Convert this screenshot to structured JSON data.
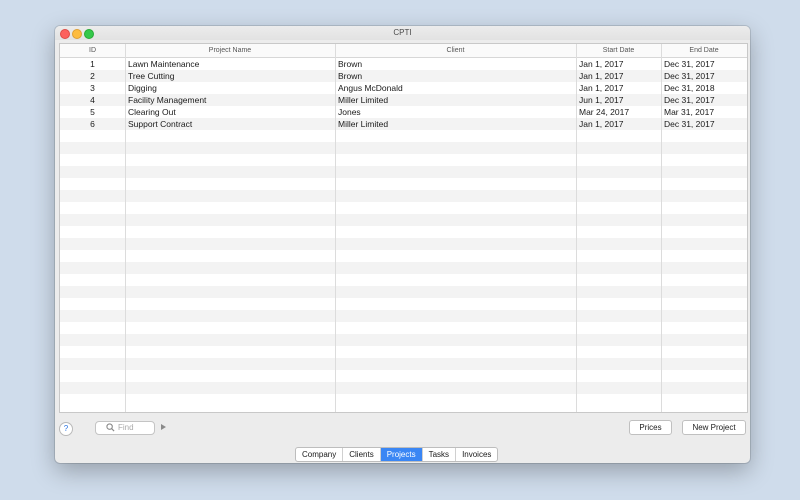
{
  "window": {
    "title": "CPTI"
  },
  "table": {
    "columns": [
      "ID",
      "Project Name",
      "Client",
      "Start Date",
      "End Date"
    ],
    "rows": [
      [
        "1",
        "Lawn Maintenance",
        "Brown",
        "Jan 1, 2017",
        "Dec 31, 2017"
      ],
      [
        "2",
        "Tree Cutting",
        "Brown",
        "Jan 1, 2017",
        "Dec 31, 2017"
      ],
      [
        "3",
        "Digging",
        "Angus McDonald",
        "Jan 1, 2017",
        "Dec 31, 2018"
      ],
      [
        "4",
        "Facility Management",
        "Miller Limited",
        "Jun 1, 2017",
        "Dec 31, 2017"
      ],
      [
        "5",
        "Clearing Out",
        "Jones",
        "Mar 24, 2017",
        "Mar 31, 2017"
      ],
      [
        "6",
        "Support Contract",
        "Miller Limited",
        "Jan 1, 2017",
        "Dec 31, 2017"
      ]
    ]
  },
  "toolbar": {
    "help_label": "?",
    "search_placeholder": "Find",
    "prices_label": "Prices",
    "new_project_label": "New Project"
  },
  "tabs": [
    {
      "label": "Company",
      "active": false
    },
    {
      "label": "Clients",
      "active": false
    },
    {
      "label": "Projects",
      "active": true
    },
    {
      "label": "Tasks",
      "active": false
    },
    {
      "label": "Invoices",
      "active": false
    }
  ],
  "colors": {
    "accent": "#3a86f4",
    "alt_row": "#f3f3f3"
  }
}
